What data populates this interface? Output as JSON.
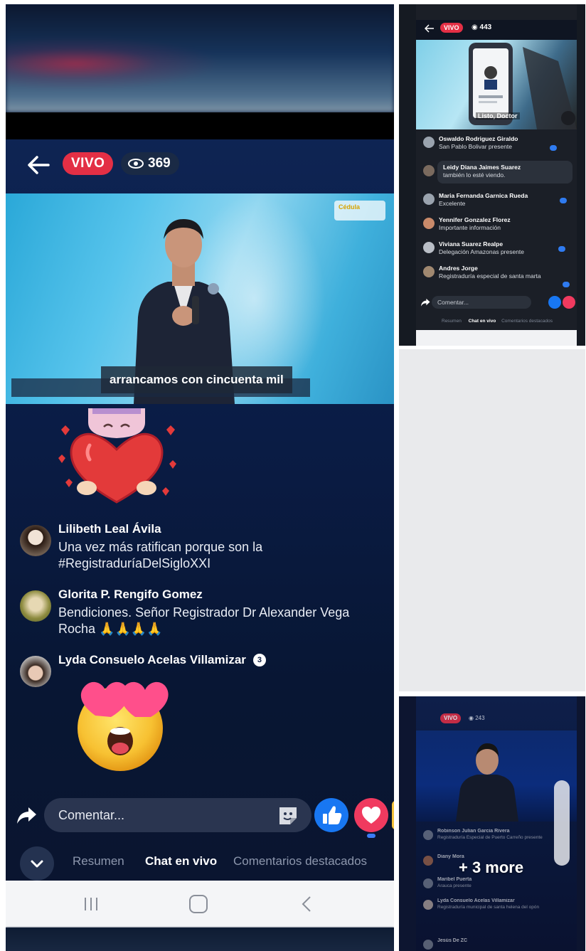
{
  "main": {
    "live_label": "VIVO",
    "viewers": "369",
    "video_logo": "Cédula",
    "subtitle": "arrancamos con cincuenta mil",
    "comments": [
      {
        "name": "Lilibeth Leal Ávila",
        "text": "Una vez más ratifican porque son la #RegistraduríaDelSigloXXI"
      },
      {
        "name": "Glorita P. Rengifo Gomez",
        "text": "Bendiciones. Señor Registrador Dr Alexander Vega Rocha 🙏🙏🙏🙏"
      },
      {
        "name": "Lyda Consuelo Acelas Villamizar",
        "badge": "3",
        "text": ""
      }
    ],
    "comment_placeholder": "Comentar...",
    "tabs": [
      "Resumen",
      "Chat en vivo",
      "Comentarios destacados"
    ],
    "active_tab": "Chat en vivo"
  },
  "thumb_top": {
    "live_label": "VIVO",
    "viewers": "443",
    "video_caption": "Listo, Doctor",
    "comments": [
      {
        "name": "Oswaldo Rodriguez Giraldo",
        "text": "San Pablo Bolivar presente"
      },
      {
        "name": "Leidy Diana Jaimes Suarez",
        "text": "también lo esté viendo."
      },
      {
        "name": "Maria Fernanda Garnica Rueda",
        "text": "Excelente"
      },
      {
        "name": "Yennifer Gonzalez Florez",
        "text": "Importante información"
      },
      {
        "name": "Viviana Suarez Realpe",
        "text": "Delegación Amazonas presente"
      },
      {
        "name": "Andres Jorge",
        "text": "Registraduría especial de santa marta"
      }
    ],
    "comment_placeholder": "Comentar...",
    "tabs": [
      "Resumen",
      "Chat en vivo",
      "Comentarios destacados"
    ]
  },
  "thumb_bottom": {
    "live_label": "VIVO",
    "viewers": "243",
    "comments": [
      {
        "name": "Robinson Julian Garcia Rivera",
        "text": "Registraduría Especial de Puerto Carreño presente"
      },
      {
        "name": "Diany Mora",
        "text": ""
      },
      {
        "name": "Maribel Puerta",
        "text": "Arauca presente"
      },
      {
        "name": "Lyda Consuelo Acelas Villamizar",
        "text": "Registraduría municipal de santa helena del opón"
      },
      {
        "name": "Jesús De ZC",
        "text": ""
      }
    ],
    "more_label": "+ 3 more"
  },
  "colors": {
    "live_red": "#e32f45",
    "like_blue": "#1877f2",
    "love_red": "#f03a5f",
    "app_bg": "#0a1c45"
  }
}
